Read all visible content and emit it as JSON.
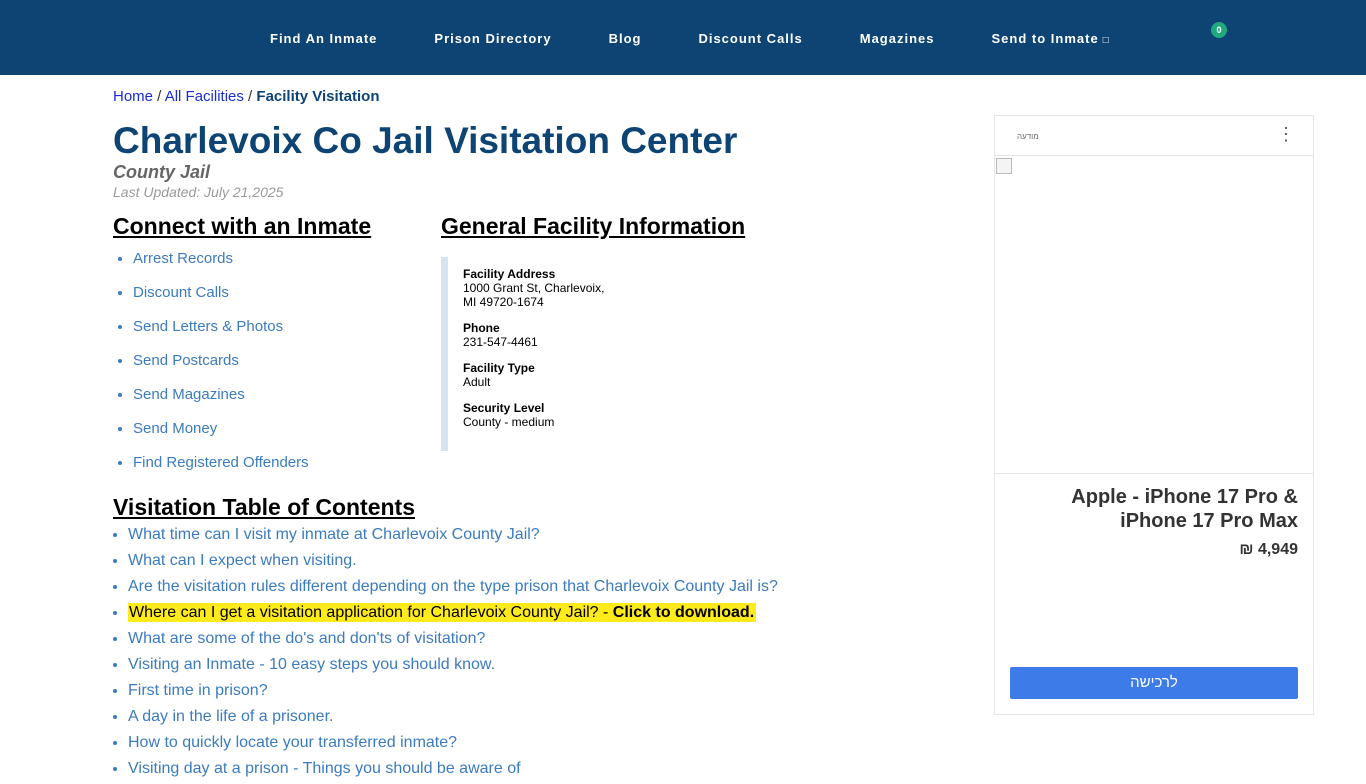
{
  "nav": {
    "items": [
      "Find An Inmate",
      "Prison Directory",
      "Blog",
      "Discount Calls",
      "Magazines",
      "Send to Inmate"
    ],
    "send_icon": "external-icon",
    "cart_count": "0"
  },
  "breadcrumb": {
    "home": "Home",
    "all_facilities": "All Facilities",
    "current": "Facility Visitation"
  },
  "page": {
    "title": "Charlevoix Co Jail Visitation Center",
    "facility_type": "County Jail",
    "last_updated": "Last Updated: July 21,2025"
  },
  "connect": {
    "heading": "Connect with an Inmate",
    "links": [
      "Arrest Records",
      "Discount Calls",
      "Send Letters & Photos",
      "Send Postcards",
      "Send Magazines",
      "Send Money",
      "Find Registered Offenders"
    ]
  },
  "general": {
    "heading": "General Facility Information",
    "address_label": "Facility Address",
    "address_line1": "1000 Grant St, Charlevoix,",
    "address_line2": "MI 49720-1674",
    "phone_label": "Phone",
    "phone": "231-547-4461",
    "type_label": "Facility Type",
    "type": "Adult",
    "security_label": "Security Level",
    "security": "County - medium"
  },
  "toc": {
    "heading": "Visitation Table of Contents",
    "items": [
      "What time can I visit my inmate at Charlevoix County Jail?",
      "What can I expect when visiting.",
      "Are the visitation rules different depending on the type prison that Charlevoix County Jail is?",
      "Where can I get a visitation application for Charlevoix County Jail? - ",
      "What are some of the do's and don'ts of visitation?",
      "Visiting an Inmate - 10 easy steps you should know.",
      "First time in prison?",
      "A day in the life of a prisoner.",
      "How to quickly locate your transferred inmate?",
      "Visiting day at a prison - Things you should be aware of"
    ],
    "download_label": "Click to download."
  },
  "ad": {
    "label": "מודעה",
    "menu_icon": "more-vertical-icon",
    "product_line1": "Apple - iPhone 17 Pro &",
    "product_line2": "iPhone 17 Pro Max",
    "price": "₪ 4,949",
    "cta": "לרכישה"
  },
  "colors": {
    "nav_bg": "#0d4474",
    "title": "#0d4474",
    "link": "#3b7bbf",
    "highlight": "#ffeb1a",
    "cart_badge": "#21a97e",
    "ad_button": "#3d7be8"
  }
}
